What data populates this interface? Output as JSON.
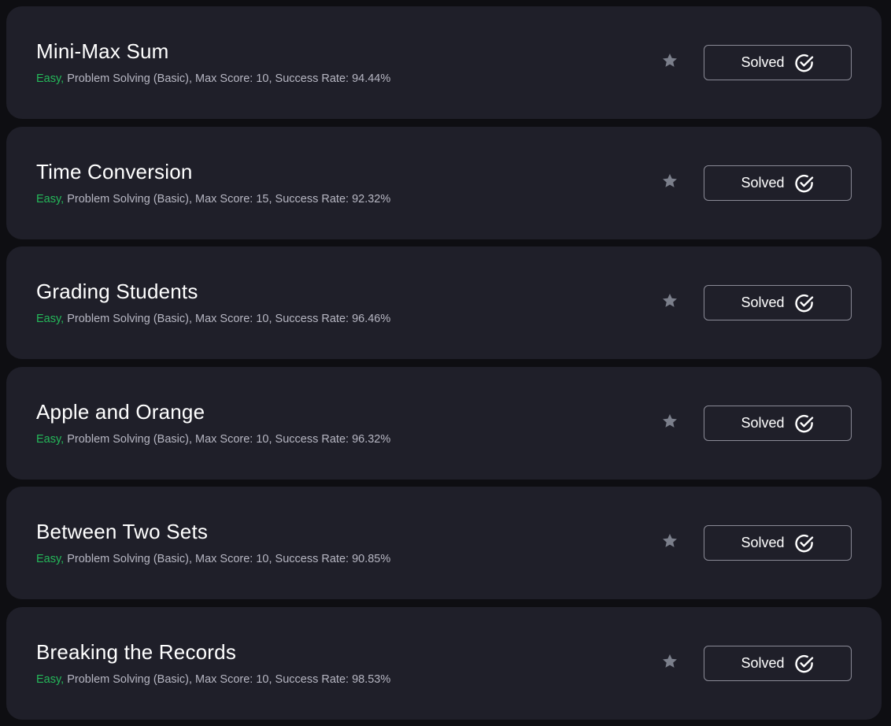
{
  "colors": {
    "page_background": "#0e0e12",
    "card_background": "#1f1f29",
    "difficulty_easy": "#25b85a",
    "meta_text": "#b6b6c2",
    "star_icon": "#7b7f8b",
    "button_border": "#8a8a96"
  },
  "icons": {
    "favorite": "star-icon",
    "solved": "check-circle-icon"
  },
  "challenges": [
    {
      "title": "Mini-Max Sum",
      "difficulty": "Easy,",
      "details": " Problem Solving (Basic), Max Score: 10, Success Rate: 94.44%",
      "status": "Solved"
    },
    {
      "title": "Time Conversion",
      "difficulty": "Easy,",
      "details": " Problem Solving (Basic), Max Score: 15, Success Rate: 92.32%",
      "status": "Solved"
    },
    {
      "title": "Grading Students",
      "difficulty": "Easy,",
      "details": " Problem Solving (Basic), Max Score: 10, Success Rate: 96.46%",
      "status": "Solved"
    },
    {
      "title": "Apple and Orange",
      "difficulty": "Easy,",
      "details": " Problem Solving (Basic), Max Score: 10, Success Rate: 96.32%",
      "status": "Solved"
    },
    {
      "title": "Between Two Sets",
      "difficulty": "Easy,",
      "details": " Problem Solving (Basic), Max Score: 10, Success Rate: 90.85%",
      "status": "Solved"
    },
    {
      "title": "Breaking the Records",
      "difficulty": "Easy,",
      "details": " Problem Solving (Basic), Max Score: 10, Success Rate: 98.53%",
      "status": "Solved"
    }
  ]
}
